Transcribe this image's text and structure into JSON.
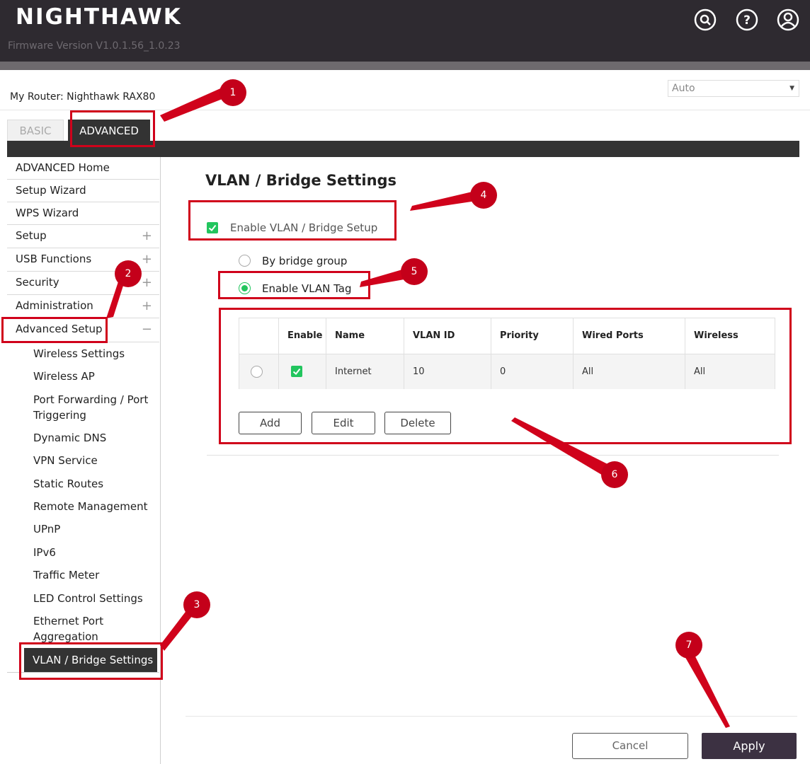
{
  "header": {
    "logo": "NIGHTHAWK",
    "firmware": "Firmware Version V1.0.1.56_1.0.23",
    "icons": [
      "search-icon",
      "help-icon",
      "account-icon"
    ]
  },
  "router": {
    "label": "My Router:",
    "name": "Nighthawk RAX80"
  },
  "language_select": {
    "value": "Auto"
  },
  "tabs": {
    "basic": "BASIC",
    "advanced": "ADVANCED"
  },
  "sidebar": {
    "items": [
      {
        "label": "ADVANCED Home",
        "expandable": false
      },
      {
        "label": "Setup Wizard",
        "expandable": false
      },
      {
        "label": "WPS Wizard",
        "expandable": false
      },
      {
        "label": "Setup",
        "expandable": true
      },
      {
        "label": "USB Functions",
        "expandable": true
      },
      {
        "label": "Security",
        "expandable": true
      },
      {
        "label": "Administration",
        "expandable": true
      },
      {
        "label": "Advanced Setup",
        "expandable": true,
        "expanded": true
      }
    ],
    "subitems": [
      "Wireless Settings",
      "Wireless AP",
      "Port Forwarding / Port Triggering",
      "Dynamic DNS",
      "VPN Service",
      "Static Routes",
      "Remote Management",
      "UPnP",
      "IPv6",
      "Traffic Meter",
      "LED Control Settings",
      "Ethernet Port Aggregation",
      "VLAN / Bridge Settings"
    ],
    "active": "VLAN / Bridge Settings"
  },
  "main": {
    "title": "VLAN / Bridge Settings",
    "enable_label": "Enable VLAN / Bridge Setup",
    "enable_checked": true,
    "radio_bridge": "By bridge group",
    "radio_vlan": "Enable VLAN Tag",
    "selected_mode": "Enable VLAN Tag",
    "table": {
      "headers": [
        "",
        "Enable",
        "Name",
        "VLAN ID",
        "Priority",
        "Wired Ports",
        "Wireless"
      ],
      "rows": [
        {
          "enabled": true,
          "name": "Internet",
          "vlan_id": "10",
          "priority": "0",
          "wired_ports": "All",
          "wireless": "All"
        }
      ]
    },
    "buttons": {
      "add": "Add",
      "edit": "Edit",
      "delete": "Delete"
    }
  },
  "footer": {
    "cancel": "Cancel",
    "apply": "Apply"
  },
  "annotations": {
    "badges": [
      "1",
      "2",
      "3",
      "4",
      "5",
      "6",
      "7"
    ],
    "color": "#c4001a"
  }
}
